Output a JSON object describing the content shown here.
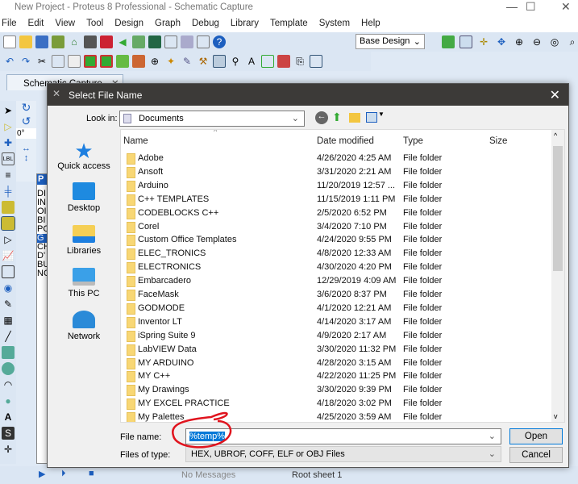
{
  "window": {
    "title": "New Project - Proteus 8 Professional - Schematic Capture",
    "minimize": "—",
    "maximize": "☐",
    "close": "✕"
  },
  "menu": [
    "File",
    "Edit",
    "View",
    "Tool",
    "Design",
    "Graph",
    "Debug",
    "Library",
    "Template",
    "System",
    "Help"
  ],
  "toolbar": {
    "design_select": "Base Design"
  },
  "tab": {
    "label": "Schematic Capture",
    "close": "✕"
  },
  "left": {
    "angle": "0°",
    "panel_header": "P",
    "panel_items": [
      "DI",
      "IN",
      "OI",
      "BI",
      "PC",
      "G",
      "CH",
      "D'",
      "BU",
      "NC"
    ],
    "selected_index": 5
  },
  "status": {
    "messages": "No Messages",
    "sheet": "Root sheet 1"
  },
  "dialog": {
    "title": "Select File Name",
    "close": "✕",
    "look_in_label": "Look in:",
    "look_in_value": "Documents",
    "places": [
      "Quick access",
      "Desktop",
      "Libraries",
      "This PC",
      "Network"
    ],
    "columns": [
      "Name",
      "Date modified",
      "Type",
      "Size"
    ],
    "files": [
      [
        "Adobe",
        "4/26/2020 4:25 AM",
        "File folder"
      ],
      [
        "Ansoft",
        "3/31/2020 2:21 AM",
        "File folder"
      ],
      [
        "Arduino",
        "11/20/2019 12:57 ...",
        "File folder"
      ],
      [
        "C++ TEMPLATES",
        "11/15/2019 1:11 PM",
        "File folder"
      ],
      [
        "CODEBLOCKS  C++",
        "2/5/2020 6:52 PM",
        "File folder"
      ],
      [
        "Corel",
        "3/4/2020 7:10 PM",
        "File folder"
      ],
      [
        "Custom Office Templates",
        "4/24/2020 9:55 PM",
        "File folder"
      ],
      [
        "ELEC_TRONICS",
        "4/8/2020 12:33 AM",
        "File folder"
      ],
      [
        "ELECTRONICS",
        "4/30/2020 4:20 PM",
        "File folder"
      ],
      [
        "Embarcadero",
        "12/29/2019 4:09 AM",
        "File folder"
      ],
      [
        "FaceMask",
        "3/6/2020 8:37 PM",
        "File folder"
      ],
      [
        "GODMODE",
        "4/1/2020 12:21 AM",
        "File folder"
      ],
      [
        "Inventor LT",
        "4/14/2020 3:17 AM",
        "File folder"
      ],
      [
        "iSpring Suite 9",
        "4/9/2020 2:17 AM",
        "File folder"
      ],
      [
        "LabVIEW Data",
        "3/30/2020 11:32 PM",
        "File folder"
      ],
      [
        "MY ARDUINO",
        "4/28/2020 3:15 AM",
        "File folder"
      ],
      [
        "MY C++",
        "4/22/2020 11:25 PM",
        "File folder"
      ],
      [
        "My Drawings",
        "3/30/2020 9:39 PM",
        "File folder"
      ],
      [
        "MY EXCEL PRACTICE",
        "4/18/2020 3:02 PM",
        "File folder"
      ],
      [
        "My Palettes",
        "4/25/2020 3:59 AM",
        "File folder"
      ]
    ],
    "file_name_label": "File name:",
    "file_name_value": "%temp%",
    "file_type_label": "Files of type:",
    "file_type_value": "HEX, UBROF, COFF, ELF or OBJ Files",
    "open": "Open",
    "cancel": "Cancel"
  },
  "colors": {
    "annotation": "#e0141e",
    "selection": "#0078d7",
    "dialog_title": "#3c3a38"
  }
}
